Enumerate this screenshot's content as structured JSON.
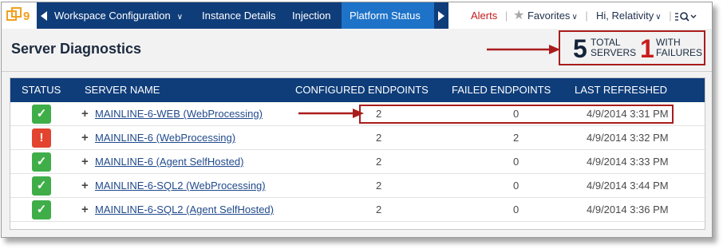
{
  "app": {
    "logo_text": "9"
  },
  "nav": {
    "tabs": [
      {
        "label": "Workspace Configuration",
        "has_dropdown": true,
        "active": false
      },
      {
        "label": "Instance Details",
        "has_dropdown": false,
        "active": false
      },
      {
        "label": "Injection",
        "has_dropdown": false,
        "active": false
      },
      {
        "label": "Platform Status",
        "has_dropdown": false,
        "active": true
      }
    ],
    "alerts_label": "Alerts",
    "separator": "|",
    "favorites_label": "Favorites",
    "user_label": "Hi, Relativity",
    "search_icon": "search-icon"
  },
  "page": {
    "title": "Server Diagnostics"
  },
  "summary": {
    "total_servers": "5",
    "total_label_line1": "TOTAL",
    "total_label_line2": "SERVERS",
    "failures": "1",
    "failures_label_line1": "WITH",
    "failures_label_line2": "FAILURES"
  },
  "table": {
    "headers": {
      "status": "STATUS",
      "server_name": "SERVER NAME",
      "configured": "CONFIGURED ENDPOINTS",
      "failed": "FAILED ENDPOINTS",
      "last": "LAST REFRESHED"
    },
    "rows": [
      {
        "status": "ok",
        "status_glyph": "✓",
        "expand": "+",
        "name": "MAINLINE-6-WEB (WebProcessing)",
        "configured": "2",
        "failed": "0",
        "last": "4/9/2014 3:31 PM"
      },
      {
        "status": "fail",
        "status_glyph": "!",
        "expand": "+",
        "name": "MAINLINE-6 (WebProcessing)",
        "configured": "2",
        "failed": "2",
        "last": "4/9/2014 3:32 PM"
      },
      {
        "status": "ok",
        "status_glyph": "✓",
        "expand": "+",
        "name": "MAINLINE-6 (Agent SelfHosted)",
        "configured": "2",
        "failed": "0",
        "last": "4/9/2014 3:33 PM"
      },
      {
        "status": "ok",
        "status_glyph": "✓",
        "expand": "+",
        "name": "MAINLINE-6-SQL2 (WebProcessing)",
        "configured": "2",
        "failed": "0",
        "last": "4/9/2014 3:44 PM"
      },
      {
        "status": "ok",
        "status_glyph": "✓",
        "expand": "+",
        "name": "MAINLINE-6-SQL2 (Agent SelfHosted)",
        "configured": "2",
        "failed": "0",
        "last": "4/9/2014 3:36 PM"
      }
    ]
  },
  "colors": {
    "nav_bg": "#0f3d7a",
    "active_tab": "#1e73c8",
    "ok": "#3fae49",
    "fail": "#e2442f",
    "annotation": "#a91c1c",
    "link": "#214a8d"
  }
}
